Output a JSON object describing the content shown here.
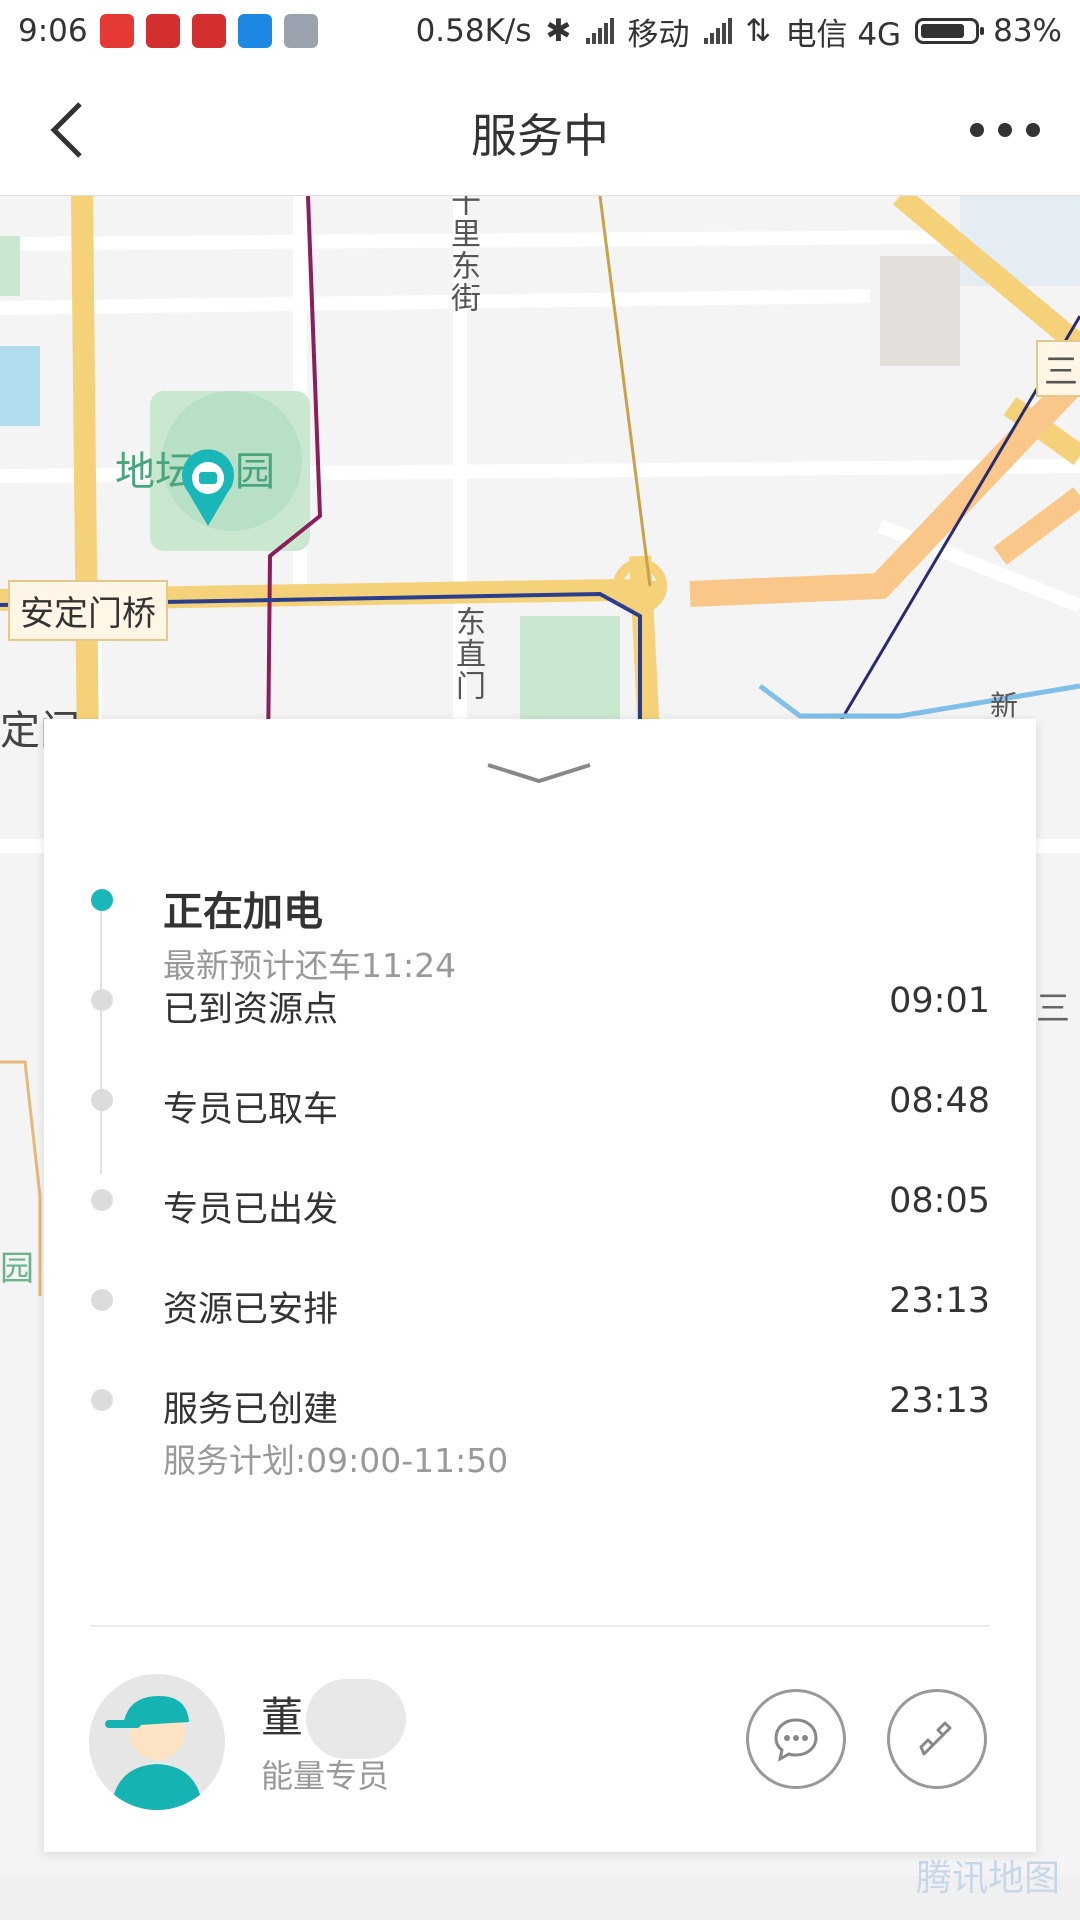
{
  "status_bar": {
    "time": "9:06",
    "net_speed": "0.58K/s",
    "carrier1": "移动",
    "carrier2": "电信 4G",
    "battery": "83%",
    "battery_level": 0.83
  },
  "nav": {
    "title": "服务中"
  },
  "map": {
    "labels": {
      "park": "地坛公园",
      "bridge": "安定门桥",
      "street1": "十里东街",
      "street2": "东直门",
      "partial_left": "定门",
      "partial_right_top": "三",
      "partial_right_mid": "三",
      "partial_right_small": "新",
      "partial_left_lower": "园"
    },
    "watermark": "腾讯地图"
  },
  "timeline": [
    {
      "title": "正在加电",
      "sub": "最新预计还车11:24",
      "time": "",
      "active": true
    },
    {
      "title": "已到资源点",
      "sub": "",
      "time": "09:01",
      "active": false
    },
    {
      "title": "专员已取车",
      "sub": "",
      "time": "08:48",
      "active": false
    },
    {
      "title": "专员已出发",
      "sub": "",
      "time": "08:05",
      "active": false
    },
    {
      "title": "资源已安排",
      "sub": "",
      "time": "23:13",
      "active": false
    },
    {
      "title": "服务已创建",
      "sub": "服务计划:09:00-11:50",
      "time": "23:13",
      "active": false
    }
  ],
  "agent": {
    "name": "董",
    "role": "能量专员"
  },
  "colors": {
    "accent": "#19b7b7",
    "road_major": "#f5c46b",
    "road_express": "#f9c78a"
  }
}
